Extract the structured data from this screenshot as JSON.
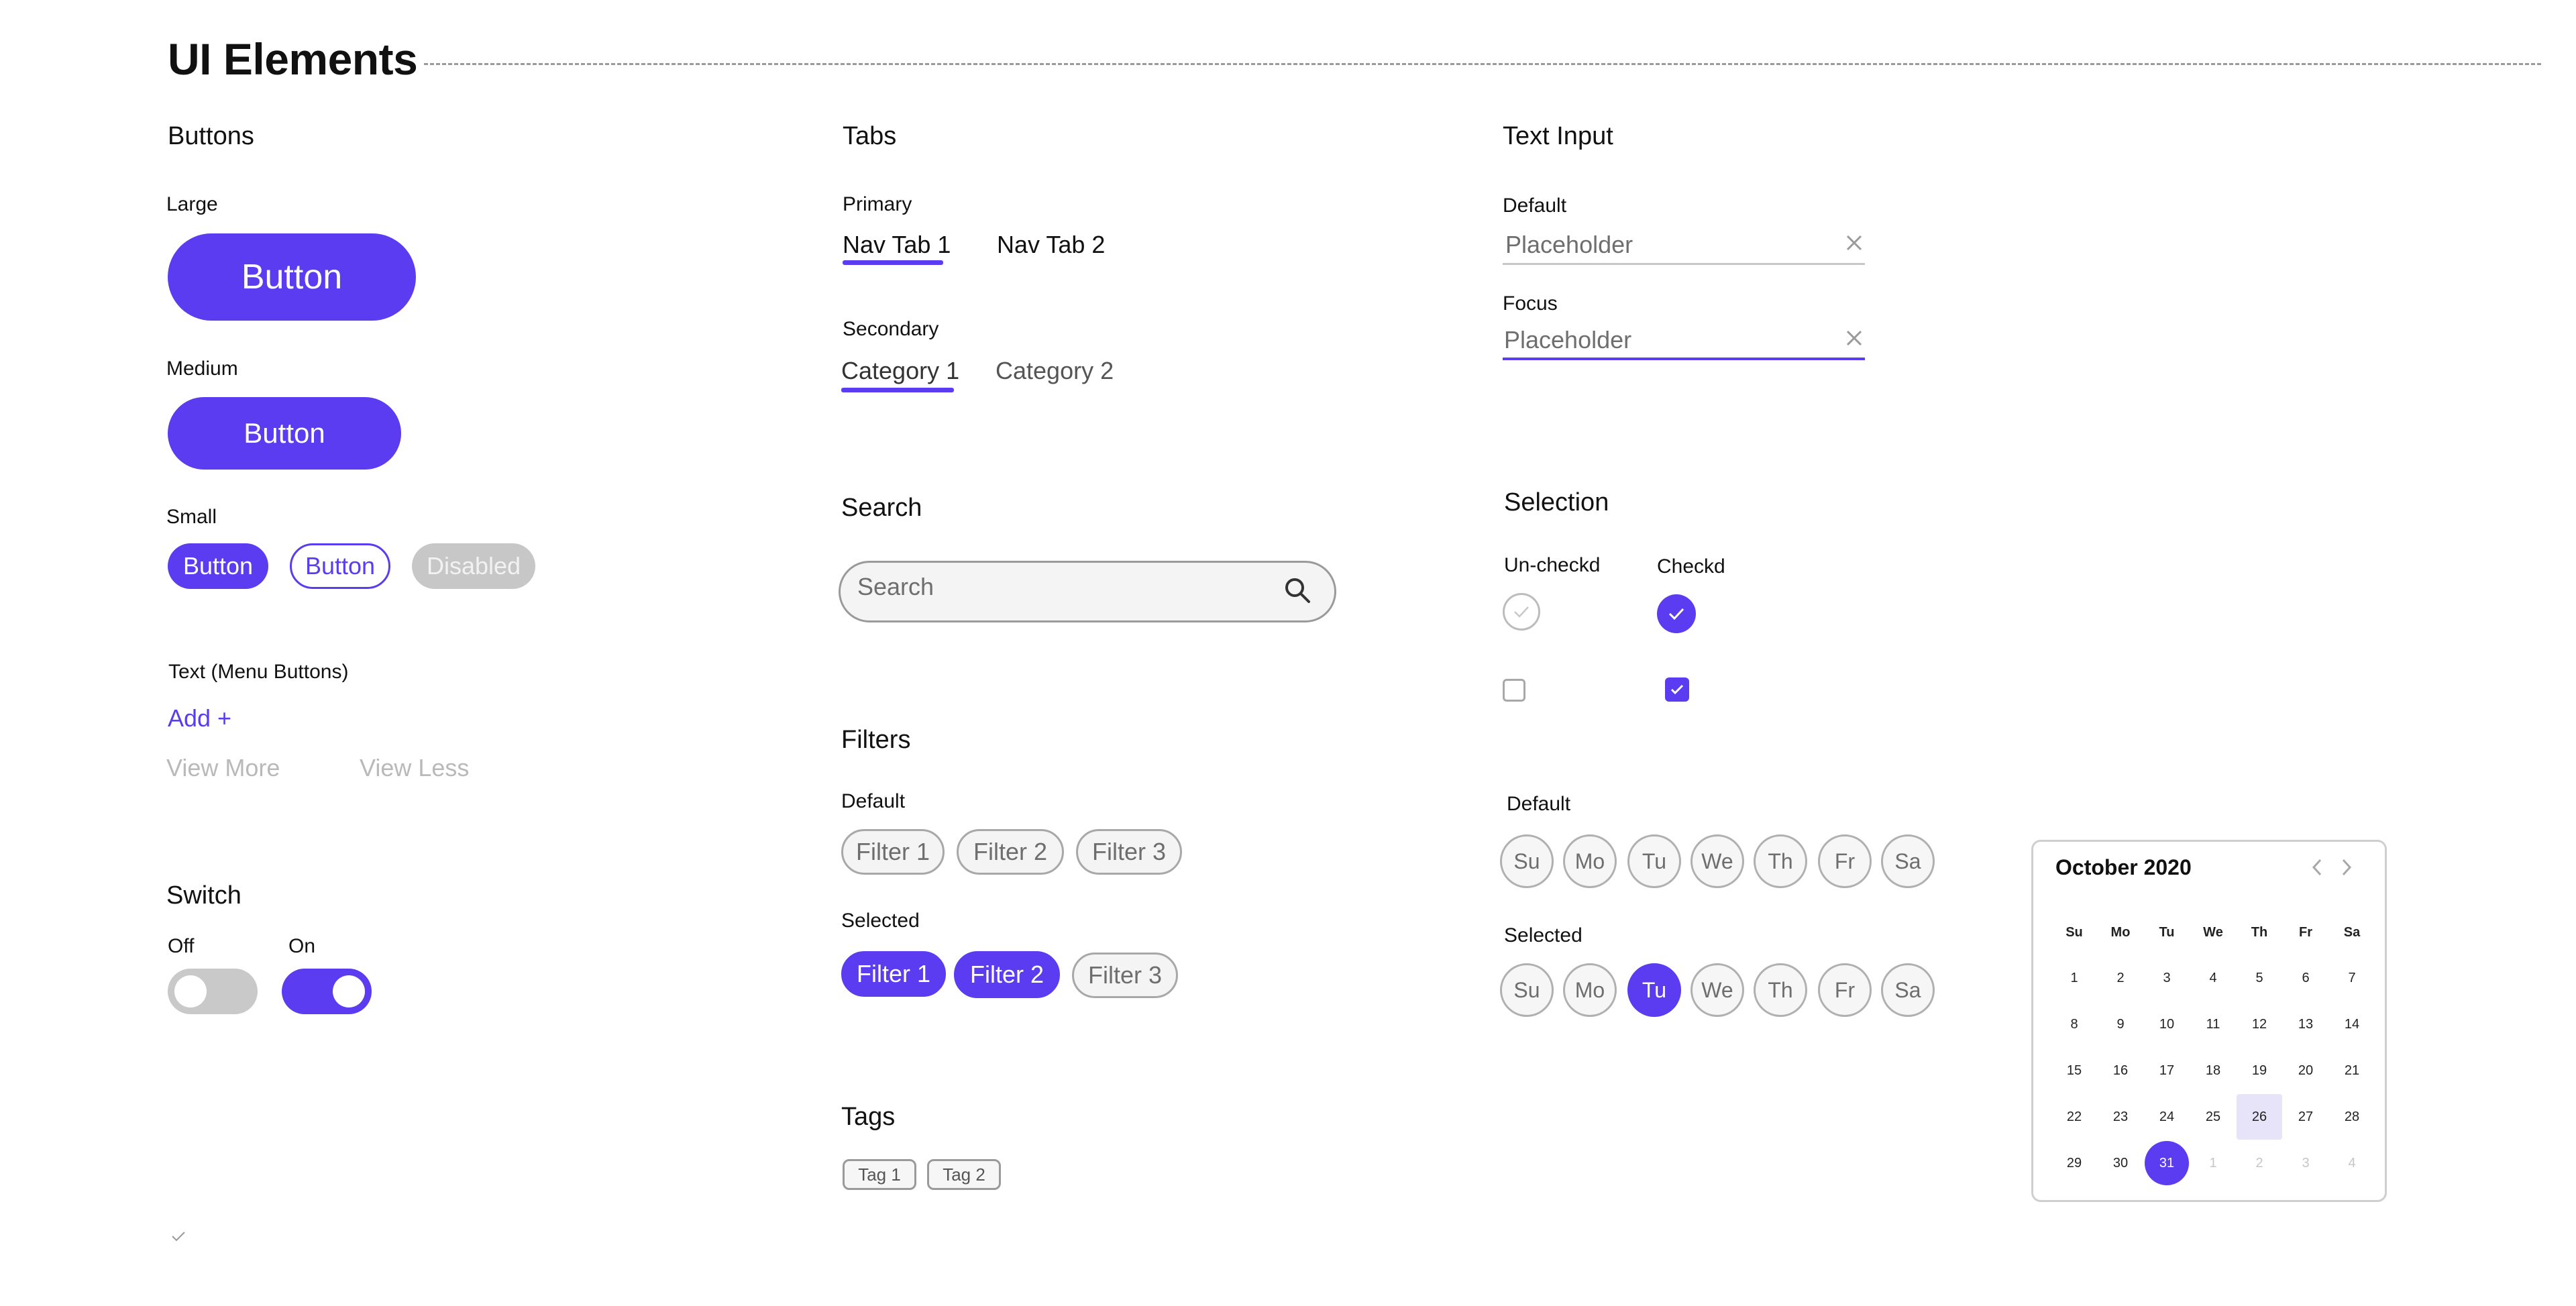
{
  "page": {
    "title": "UI Elements"
  },
  "colors": {
    "accent": "#5b3cf0",
    "disabled": "#c7c7c7",
    "border": "#a8a8a8",
    "muted_text": "#b9b9b9"
  },
  "buttons": {
    "heading": "Buttons",
    "large_label": "Large",
    "large_button": "Button",
    "medium_label": "Medium",
    "medium_button": "Button",
    "small_label": "Small",
    "small_primary": "Button",
    "small_outline": "Button",
    "small_disabled": "Disabled",
    "text_label": "Text (Menu Buttons)",
    "add": "Add +",
    "view_more": "View More",
    "view_less": "View Less"
  },
  "switch": {
    "heading": "Switch",
    "off_label": "Off",
    "on_label": "On"
  },
  "tabs": {
    "heading": "Tabs",
    "primary_label": "Primary",
    "primary": [
      "Nav Tab 1",
      "Nav Tab 2"
    ],
    "secondary_label": "Secondary",
    "secondary": [
      "Category 1",
      "Category 2"
    ]
  },
  "search": {
    "heading": "Search",
    "placeholder": "Search",
    "icon": "search-icon"
  },
  "filters": {
    "heading": "Filters",
    "default_label": "Default",
    "default": [
      "Filter 1",
      "Filter 2",
      "Filter 3"
    ],
    "selected_label": "Selected",
    "selected": [
      {
        "label": "Filter 1",
        "selected": true
      },
      {
        "label": "Filter 2",
        "selected": true
      },
      {
        "label": "Filter 3",
        "selected": false
      }
    ]
  },
  "tags": {
    "heading": "Tags",
    "items": [
      "Tag 1",
      "Tag 2"
    ]
  },
  "text_input": {
    "heading": "Text Input",
    "default_label": "Default",
    "default_placeholder": "Placeholder",
    "focus_label": "Focus",
    "focus_placeholder": "Placeholder",
    "clear_icon": "close-icon"
  },
  "selection": {
    "heading": "Selection",
    "unchecked_label": "Un-checkd",
    "checked_label": "Checkd"
  },
  "days": {
    "default_label": "Default",
    "selected_label": "Selected",
    "items": [
      "Su",
      "Mo",
      "Tu",
      "We",
      "Th",
      "Fr",
      "Sa"
    ],
    "selected_index": 2
  },
  "calendar": {
    "title": "October 2020",
    "prev_icon": "chevron-left-icon",
    "next_icon": "chevron-right-icon",
    "weekdays": [
      "Su",
      "Mo",
      "Tu",
      "We",
      "Th",
      "Fr",
      "Sa"
    ],
    "weeks": [
      [
        "1",
        "2",
        "3",
        "4",
        "5",
        "6",
        "7"
      ],
      [
        "8",
        "9",
        "10",
        "11",
        "12",
        "13",
        "14"
      ],
      [
        "15",
        "16",
        "17",
        "18",
        "19",
        "20",
        "21"
      ],
      [
        "22",
        "23",
        "24",
        "25",
        "26",
        "27",
        "28"
      ],
      [
        "29",
        "30",
        "31",
        "1",
        "2",
        "3",
        "4"
      ]
    ],
    "highlighted": "26",
    "selected": "31"
  }
}
